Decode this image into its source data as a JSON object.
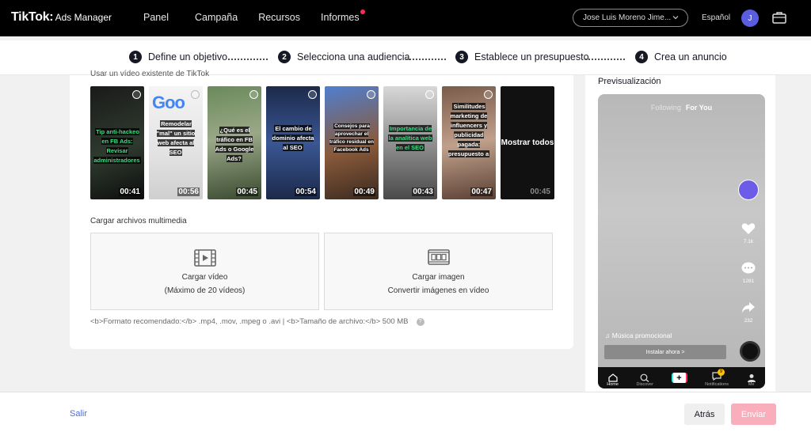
{
  "app": {
    "brand": "TikTok",
    "product": "Ads Manager"
  },
  "nav": {
    "items": [
      "Panel",
      "Campaña",
      "Recursos",
      "Informes"
    ]
  },
  "header": {
    "account": "Jose Luis Moreno Jime...",
    "language": "Español",
    "avatar_initial": "J"
  },
  "stepper": {
    "steps": [
      {
        "num": "1",
        "label": "Define un objetivo"
      },
      {
        "num": "2",
        "label": "Selecciona una audiencia"
      },
      {
        "num": "3",
        "label": "Establece un presupuesto"
      },
      {
        "num": "4",
        "label": "Crea un anuncio"
      }
    ]
  },
  "main": {
    "existing_label": "Usar un vídeo existente de TikTok",
    "thumbnails": [
      {
        "caption": "Tip anti-hackeo en FB Ads: Revisar administradores",
        "duration": "00:41"
      },
      {
        "caption": "Remodelar \"mal\" un sitio web afecta al SEO",
        "duration": "00:56"
      },
      {
        "caption": "¿Qué es el tráfico en FB Ads o Google Ads?",
        "duration": "00:45"
      },
      {
        "caption": "El cambio de dominio afecta al SEO",
        "duration": "00:54"
      },
      {
        "caption": "Consejos para aprovechar el tráfico residual en Facebook Ads",
        "duration": "00:49"
      },
      {
        "caption": "Importancia de la analítica web en el SEO",
        "duration": "00:43"
      },
      {
        "caption": "Similitudes marketing de influencers y publicidad pagada: presupuesto a",
        "duration": "00:47"
      }
    ],
    "show_all": {
      "label": "Mostrar todos",
      "duration": "00:45"
    },
    "upload_title": "Cargar archivos multimedia",
    "upload_video": {
      "line1": "Cargar vídeo",
      "line2": "(Máximo de 20 vídeos)"
    },
    "upload_image": {
      "line1": "Cargar imagen",
      "line2": "Convertir imágenes en vídeo"
    },
    "format_note": "<b>Formato recomendado:</b> .mp4, .mov, .mpeg o .avi | <b>Tamaño de archivo:</b> 500 MB",
    "help_icon": "?"
  },
  "preview": {
    "title": "Previsualización",
    "tab_following": "Following",
    "tab_foryou": "For You",
    "likes": "7.1k",
    "comments": "1281",
    "shares": "232",
    "music": "♫ Música promocional",
    "install": "Instalar ahora >",
    "tabs": [
      "Home",
      "Discover",
      "",
      "Notifications",
      "Me"
    ],
    "notif_badge": "9"
  },
  "footer": {
    "exit": "Salir",
    "back": "Atrás",
    "send": "Enviar"
  },
  "colors": {
    "accent": "#fe2c55",
    "send_disabled": "#f8aebb",
    "link": "#4f6dd9"
  }
}
